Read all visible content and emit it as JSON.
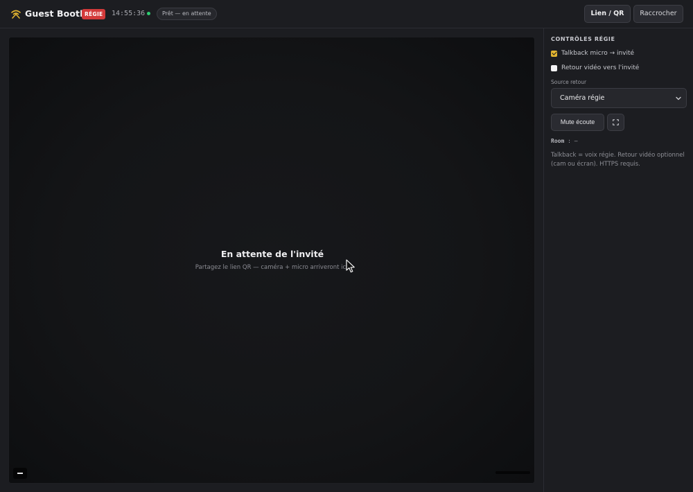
{
  "header": {
    "title": "Guest Booth",
    "role_badge": "RÉGIE",
    "clock": "14:55:36",
    "status": "Prêt — en attente",
    "link_button": "Lien / QR",
    "hangup_button": "Raccrocher",
    "icons": {
      "logo": "broadcast-icon",
      "live": "live-dot-icon"
    },
    "colors": {
      "badge": "#d33a3a",
      "live_dot": "#2ecc71",
      "accent": "#e3b531"
    }
  },
  "stage": {
    "title": "En attente de l'invité",
    "subtitle": "Partagez le lien QR — caméra + micro arriveront ici."
  },
  "sidebar": {
    "heading": "CONTRÔLES RÉGIE",
    "talkback": {
      "label": "Talkback micro → invité",
      "checked": true
    },
    "video_return": {
      "label": "Retour vidéo vers l'invité",
      "checked": false
    },
    "source_label": "Source retour",
    "source_value": "Caméra régie",
    "mute_button": "Mute écoute",
    "room_label": "Room",
    "room_separator": ":",
    "room_value": "—",
    "help_text": "Talkback = voix régie. Retour vidéo optionnel (cam ou écran). HTTPS requis."
  }
}
